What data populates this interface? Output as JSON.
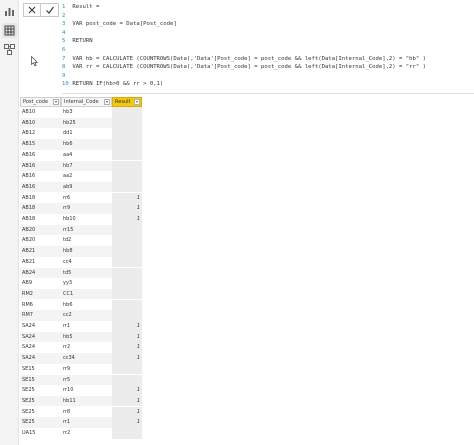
{
  "rail": {
    "icons": [
      "report-view-icon",
      "table-view-icon",
      "model-view-icon"
    ]
  },
  "formula": {
    "cancel_icon": "close-icon",
    "commit_icon": "check-icon",
    "lines": [
      {
        "n": "1",
        "text": "Result ="
      },
      {
        "n": "2",
        "text": ""
      },
      {
        "n": "3",
        "text": "VAR post_code = Data[Post_code]"
      },
      {
        "n": "4",
        "text": ""
      },
      {
        "n": "5",
        "text": "RETURN"
      },
      {
        "n": "6",
        "text": ""
      },
      {
        "n": "7",
        "text": "VAR hb = CALCULATE (COUNTROWS(Data),'Data'[Post_code] = post_code && left(Data[Internal_Code],2) = \"hb\" )"
      },
      {
        "n": "8",
        "text": "VAR rr = CALCULATE (COUNTROWS(Data),'Data'[Post_code] = post_code && left(Data[Internal_Code],2) = \"rr\" )"
      },
      {
        "n": "9",
        "text": ""
      },
      {
        "n": "10",
        "text": "RETURN IF(hb>0 && rr > 0,1)"
      }
    ]
  },
  "table": {
    "columns": [
      "Post_code",
      "Internal_Code",
      "Result"
    ],
    "rows": [
      [
        "AB10",
        "hb3",
        ""
      ],
      [
        "AB10",
        "hb25",
        ""
      ],
      [
        "AB12",
        "dd1",
        ""
      ],
      [
        "AB15",
        "hb6",
        ""
      ],
      [
        "AB16",
        "aa4",
        ""
      ],
      [
        "AB16",
        "hb7",
        ""
      ],
      [
        "AB16",
        "aa2",
        ""
      ],
      [
        "AB16",
        "ab9",
        ""
      ],
      [
        "AB18",
        "rr6",
        "1"
      ],
      [
        "AB18",
        "rr9",
        "1"
      ],
      [
        "AB18",
        "hb10",
        "1"
      ],
      [
        "AB20",
        "rr15",
        ""
      ],
      [
        "AB20",
        "td2",
        ""
      ],
      [
        "AB21",
        "hb8",
        ""
      ],
      [
        "AB21",
        "cc4",
        ""
      ],
      [
        "AB24",
        "td5",
        ""
      ],
      [
        "AB9",
        "yy3",
        ""
      ],
      [
        "RM2",
        "CC1",
        ""
      ],
      [
        "RM6",
        "hb6",
        ""
      ],
      [
        "RM7",
        "cc2",
        ""
      ],
      [
        "SA24",
        "rr1",
        "1"
      ],
      [
        "SA24",
        "hb5",
        "1"
      ],
      [
        "SA24",
        "rr2",
        "1"
      ],
      [
        "SA24",
        "cc34",
        "1"
      ],
      [
        "SE15",
        "rr9",
        ""
      ],
      [
        "SE15",
        "rr5",
        ""
      ],
      [
        "SE25",
        "rr10",
        "1"
      ],
      [
        "SE25",
        "hb11",
        "1"
      ],
      [
        "SE25",
        "rr8",
        "1"
      ],
      [
        "SE25",
        "rr1",
        "1"
      ],
      [
        "UA15",
        "rr2",
        ""
      ]
    ]
  }
}
